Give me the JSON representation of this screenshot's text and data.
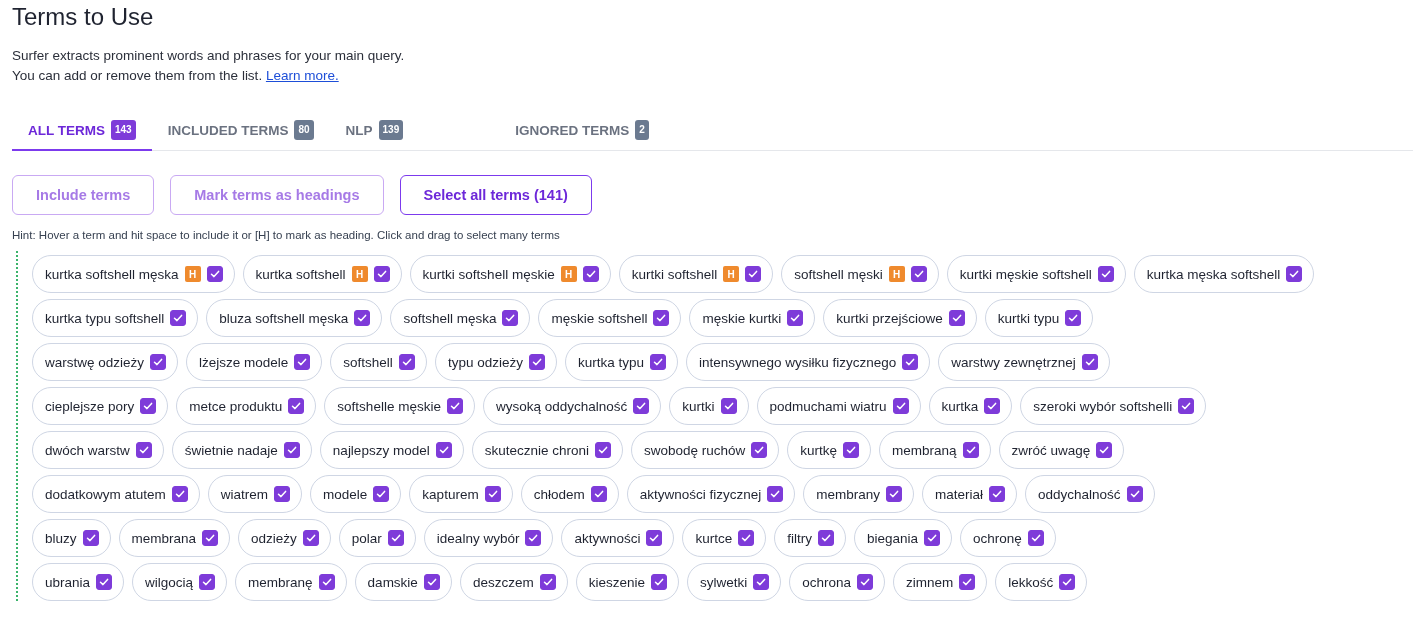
{
  "title": "Terms to Use",
  "description": [
    "Surfer extracts prominent words and phrases for your main query.",
    "You can add or remove them from the list."
  ],
  "learn_more_link": "Learn more.",
  "tabs": [
    {
      "label": "ALL TERMS",
      "count": "143",
      "selected": true
    },
    {
      "label": "INCLUDED TERMS",
      "count": "80",
      "selected": false
    },
    {
      "label": "NLP",
      "count": "139",
      "selected": false
    },
    {
      "label": "IGNORED TERMS",
      "count": "2",
      "selected": false
    }
  ],
  "buttons": [
    {
      "label": "Include terms",
      "disabled": true
    },
    {
      "label": "Mark terms as headings",
      "disabled": true
    },
    {
      "label": "Select all terms (141)",
      "disabled": false
    }
  ],
  "hint": "Hint: Hover a term and hit space to include it or [H] to mark as heading. Click and drag to select many terms",
  "term_rows": [
    [
      {
        "text": "kurtka softshell męska",
        "heading_badge": "H",
        "checked": true
      },
      {
        "text": "kurtka softshell",
        "heading_badge": "H",
        "checked": true
      },
      {
        "text": "kurtki softshell męskie",
        "heading_badge": "H",
        "checked": true
      },
      {
        "text": "kurtki softshell",
        "heading_badge": "H",
        "checked": true
      },
      {
        "text": "softshell męski",
        "heading_badge": "H",
        "checked": true
      },
      {
        "text": "kurtki męskie softshell",
        "checked": true
      },
      {
        "text": "kurtka męska softshell",
        "checked": true
      }
    ],
    [
      {
        "text": "kurtka typu softshell",
        "checked": true
      },
      {
        "text": "bluza softshell męska",
        "checked": true
      },
      {
        "text": "softshell męska",
        "checked": true
      },
      {
        "text": "męskie softshell",
        "checked": true
      },
      {
        "text": "męskie kurtki",
        "checked": true
      },
      {
        "text": "kurtki przejściowe",
        "checked": true
      },
      {
        "text": "kurtki typu",
        "checked": true
      }
    ],
    [
      {
        "text": "warstwę odzieży",
        "checked": true
      },
      {
        "text": "lżejsze modele",
        "checked": true
      },
      {
        "text": "softshell",
        "checked": true
      },
      {
        "text": "typu odzieży",
        "checked": true
      },
      {
        "text": "kurtka typu",
        "checked": true
      },
      {
        "text": "intensywnego wysiłku fizycznego",
        "checked": true
      },
      {
        "text": "warstwy zewnętrznej",
        "checked": true
      }
    ],
    [
      {
        "text": "cieplejsze pory",
        "checked": true
      },
      {
        "text": "metce produktu",
        "checked": true
      },
      {
        "text": "softshelle męskie",
        "checked": true
      },
      {
        "text": "wysoką oddychalność",
        "checked": true
      },
      {
        "text": "kurtki",
        "checked": true
      },
      {
        "text": "podmuchami wiatru",
        "checked": true
      },
      {
        "text": "kurtka",
        "checked": true
      },
      {
        "text": "szeroki wybór softshelli",
        "checked": true
      }
    ],
    [
      {
        "text": "dwóch warstw",
        "checked": true
      },
      {
        "text": "świetnie nadaje",
        "checked": true
      },
      {
        "text": "najlepszy model",
        "checked": true
      },
      {
        "text": "skutecznie chroni",
        "checked": true
      },
      {
        "text": "swobodę ruchów",
        "checked": true
      },
      {
        "text": "kurtkę",
        "checked": true
      },
      {
        "text": "membraną",
        "checked": true
      },
      {
        "text": "zwróć uwagę",
        "checked": true
      }
    ],
    [
      {
        "text": "dodatkowym atutem",
        "checked": true
      },
      {
        "text": "wiatrem",
        "checked": true
      },
      {
        "text": "modele",
        "checked": true
      },
      {
        "text": "kapturem",
        "checked": true
      },
      {
        "text": "chłodem",
        "checked": true
      },
      {
        "text": "aktywności fizycznej",
        "checked": true
      },
      {
        "text": "membrany",
        "checked": true
      },
      {
        "text": "materiał",
        "checked": true
      },
      {
        "text": "oddychalność",
        "checked": true
      }
    ],
    [
      {
        "text": "bluzy",
        "checked": true
      },
      {
        "text": "membrana",
        "checked": true
      },
      {
        "text": "odzieży",
        "checked": true
      },
      {
        "text": "polar",
        "checked": true
      },
      {
        "text": "idealny wybór",
        "checked": true
      },
      {
        "text": "aktywności",
        "checked": true
      },
      {
        "text": "kurtce",
        "checked": true
      },
      {
        "text": "filtry",
        "checked": true
      },
      {
        "text": "biegania",
        "checked": true
      },
      {
        "text": "ochronę",
        "checked": true
      }
    ],
    [
      {
        "text": "ubrania",
        "checked": true
      },
      {
        "text": "wilgocią",
        "checked": true
      },
      {
        "text": "membranę",
        "checked": true
      },
      {
        "text": "damskie",
        "checked": true
      },
      {
        "text": "deszczem",
        "checked": true
      },
      {
        "text": "kieszenie",
        "checked": true
      },
      {
        "text": "sylwetki",
        "checked": true
      },
      {
        "text": "ochrona",
        "checked": true
      },
      {
        "text": "zimnem",
        "checked": true
      },
      {
        "text": "lekkość",
        "checked": true
      }
    ]
  ]
}
